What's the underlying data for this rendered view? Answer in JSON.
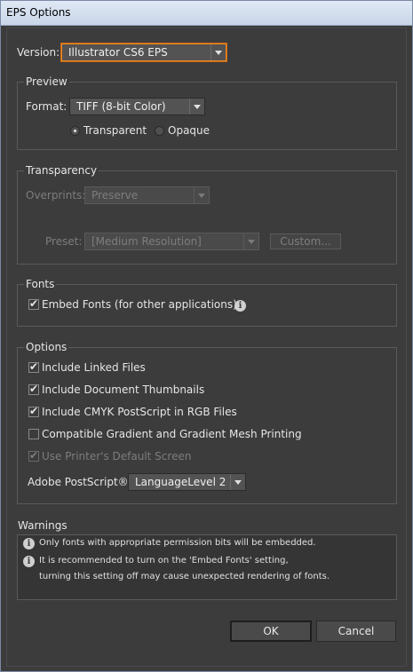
{
  "window": {
    "title": "EPS Options"
  },
  "version": {
    "label": "Version:",
    "value": "Illustrator CS6 EPS"
  },
  "preview": {
    "title": "Preview",
    "format_label": "Format:",
    "format_value": "TIFF (8-bit Color)",
    "transparent_label": "Transparent",
    "opaque_label": "Opaque",
    "selected": "Transparent"
  },
  "transparency": {
    "title": "Transparency",
    "overprints_label": "Overprints:",
    "overprints_value": "Preserve",
    "preset_label": "Preset:",
    "preset_value": "[Medium Resolution]",
    "custom_label": "Custom..."
  },
  "fonts": {
    "title": "Fonts",
    "embed_label": "Embed Fonts (for other applications)",
    "embed_checked": true
  },
  "options": {
    "title": "Options",
    "items": [
      {
        "label": "Include Linked Files",
        "checked": true,
        "enabled": true
      },
      {
        "label": "Include Document Thumbnails",
        "checked": true,
        "enabled": true
      },
      {
        "label": "Include CMYK PostScript in RGB Files",
        "checked": true,
        "enabled": true
      },
      {
        "label": "Compatible Gradient and Gradient Mesh Printing",
        "checked": false,
        "enabled": true
      },
      {
        "label": "Use Printer's Default Screen",
        "checked": true,
        "enabled": false
      }
    ],
    "postscript_label": "Adobe PostScript®:",
    "postscript_value": "LanguageLevel 2"
  },
  "warnings": {
    "title": "Warnings",
    "lines": [
      "Only fonts with appropriate permission bits will be embedded.",
      "It is recommended to turn on the 'Embed Fonts' setting,",
      "turning this setting off may cause unexpected rendering of fonts."
    ]
  },
  "buttons": {
    "ok": "OK",
    "cancel": "Cancel"
  }
}
